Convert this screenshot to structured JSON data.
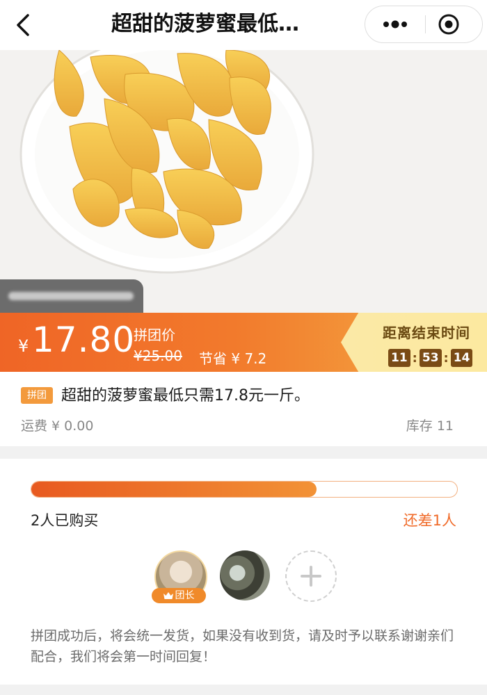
{
  "header": {
    "title": "超甜的菠萝蜜最低…",
    "back_icon": "back-chevron-icon",
    "more_icon": "more-dots-icon",
    "close_icon": "target-close-icon"
  },
  "hero": {
    "image": "jackfruit-plate"
  },
  "price": {
    "currency": "¥",
    "amount": "17.80",
    "group_label": "拼团价",
    "original": "¥25.00",
    "save": "节省 ¥ 7.2"
  },
  "countdown": {
    "label": "距离结束时间",
    "hours": "11",
    "minutes": "53",
    "seconds": "14"
  },
  "product": {
    "badge": "拼团",
    "title": "超甜的菠萝蜜最低只需17.8元一斤。",
    "shipping": "运费 ¥ 0.00",
    "stock": "库存 11"
  },
  "group": {
    "progress_fraction": 0.67,
    "bought": "2人已购买",
    "remaining": "还差1人",
    "leader_label": "团长",
    "notice": "拼团成功后，将会统一发货，如果没有收到货，请及时予以联系谢谢亲们配合，我们将会第一时间回复！"
  },
  "colors": {
    "accent": "#ef6526",
    "countdown_bg": "#fbe9a6",
    "timer_box": "#7a4b15"
  }
}
